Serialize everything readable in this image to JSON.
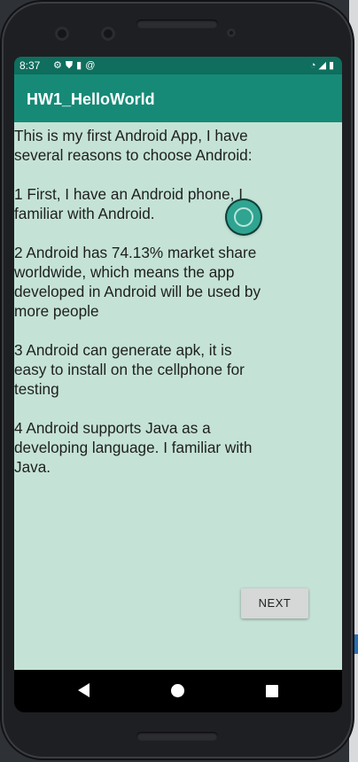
{
  "status_bar": {
    "time": "8:37",
    "left_icons": [
      "gear-icon",
      "shield-icon",
      "sd-card-icon",
      "at-icon"
    ],
    "right_icons": [
      "wifi-icon",
      "signal-icon",
      "battery-icon"
    ]
  },
  "app_bar": {
    "title": "HW1_HelloWorld",
    "color": "#168a77"
  },
  "content": {
    "background": "#c4e3d6",
    "body_text": "This is my first Android App, I have several reasons to choose Android:\n\n1 First, I have an Android phone, I familiar with Android.\n\n2 Android has 74.13% market share worldwide, which means the app developed in Android will be used by more people\n\n3 Android can generate apk, it is easy to install on the cellphone for testing\n\n4 Android supports Java as a developing language. I familiar with Java.",
    "next_label": "NEXT"
  },
  "nav_bar": {
    "buttons": [
      "back-icon",
      "home-icon",
      "recents-icon"
    ]
  }
}
